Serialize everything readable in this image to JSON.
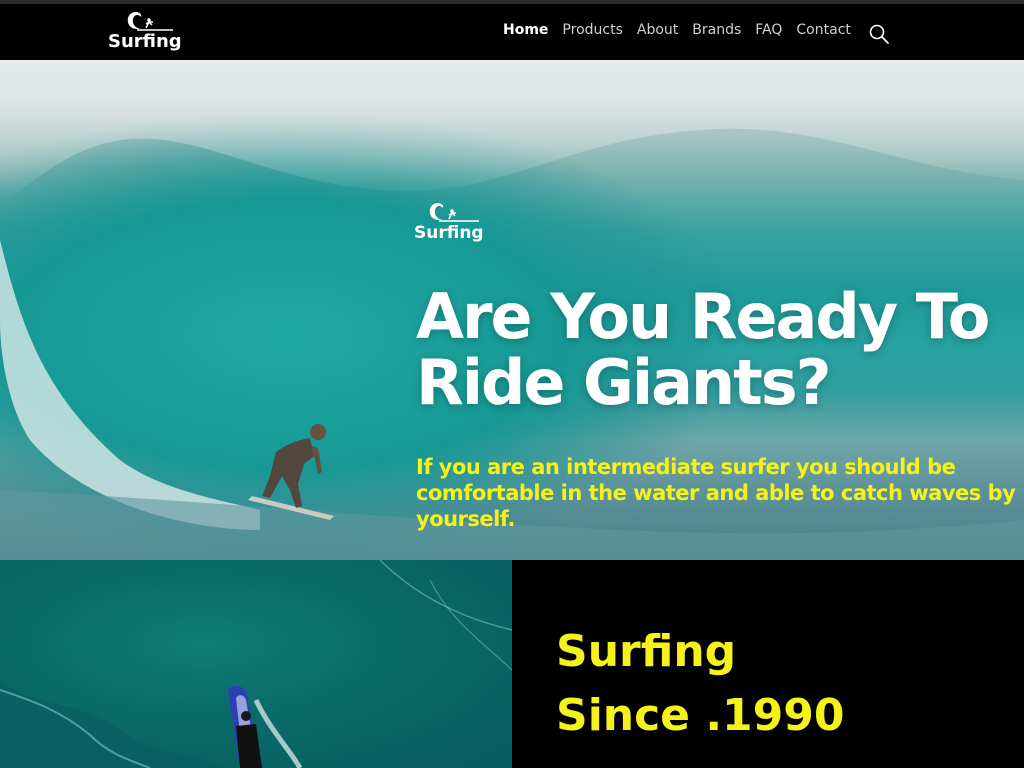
{
  "brand": {
    "name": "Surfing"
  },
  "nav": {
    "items": [
      {
        "label": "Home",
        "active": true
      },
      {
        "label": "Products",
        "active": false
      },
      {
        "label": "About",
        "active": false
      },
      {
        "label": "Brands",
        "active": false
      },
      {
        "label": "FAQ",
        "active": false
      },
      {
        "label": "Contact",
        "active": false
      }
    ],
    "search_icon": "search-icon"
  },
  "hero": {
    "logo_text": "Surfing",
    "title_line1": "Are You Ready To",
    "title_line2": "Ride Giants?",
    "subtitle": "If you are an intermediate surfer you should be comfortable in the water and able to catch waves by yourself."
  },
  "about": {
    "heading_line1": "Surfing",
    "heading_line2": "Since .1990"
  },
  "colors": {
    "accent_yellow": "#f4f21a",
    "nav_background": "#000000",
    "text_white": "#ffffff"
  }
}
